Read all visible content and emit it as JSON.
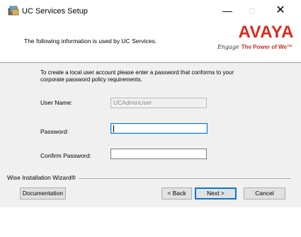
{
  "window": {
    "title": "UC Services Setup",
    "minimize_glyph": "—",
    "maximize_glyph": "□",
    "close_glyph": "✕"
  },
  "header": {
    "text": "The following information is used by UC Services.",
    "logo": {
      "wordmark": "AVAYA",
      "tagline_script": "Engage",
      "tagline": "The Power of We",
      "trademark": "™"
    }
  },
  "instruction": "To create a local user account please enter a password that conforms to your corporate password policy requirements.",
  "form": {
    "username_label": "User Name:",
    "username_value": "UCAdminUser",
    "password_label": "Password:",
    "password_value": "",
    "confirm_label": "Confirm Password:",
    "confirm_value": ""
  },
  "footer": {
    "wizard_label": "Wise Installation Wizard®",
    "documentation_button": "Documentation",
    "back_button": "< Back",
    "next_button": "Next >",
    "cancel_button": "Cancel"
  },
  "colors": {
    "brand_red": "#d52b1e",
    "focus_blue": "#0078d7",
    "dialog_bg": "#f0f0f0"
  },
  "icons": [
    "installer-icon",
    "minimize-icon",
    "maximize-icon",
    "close-icon"
  ]
}
